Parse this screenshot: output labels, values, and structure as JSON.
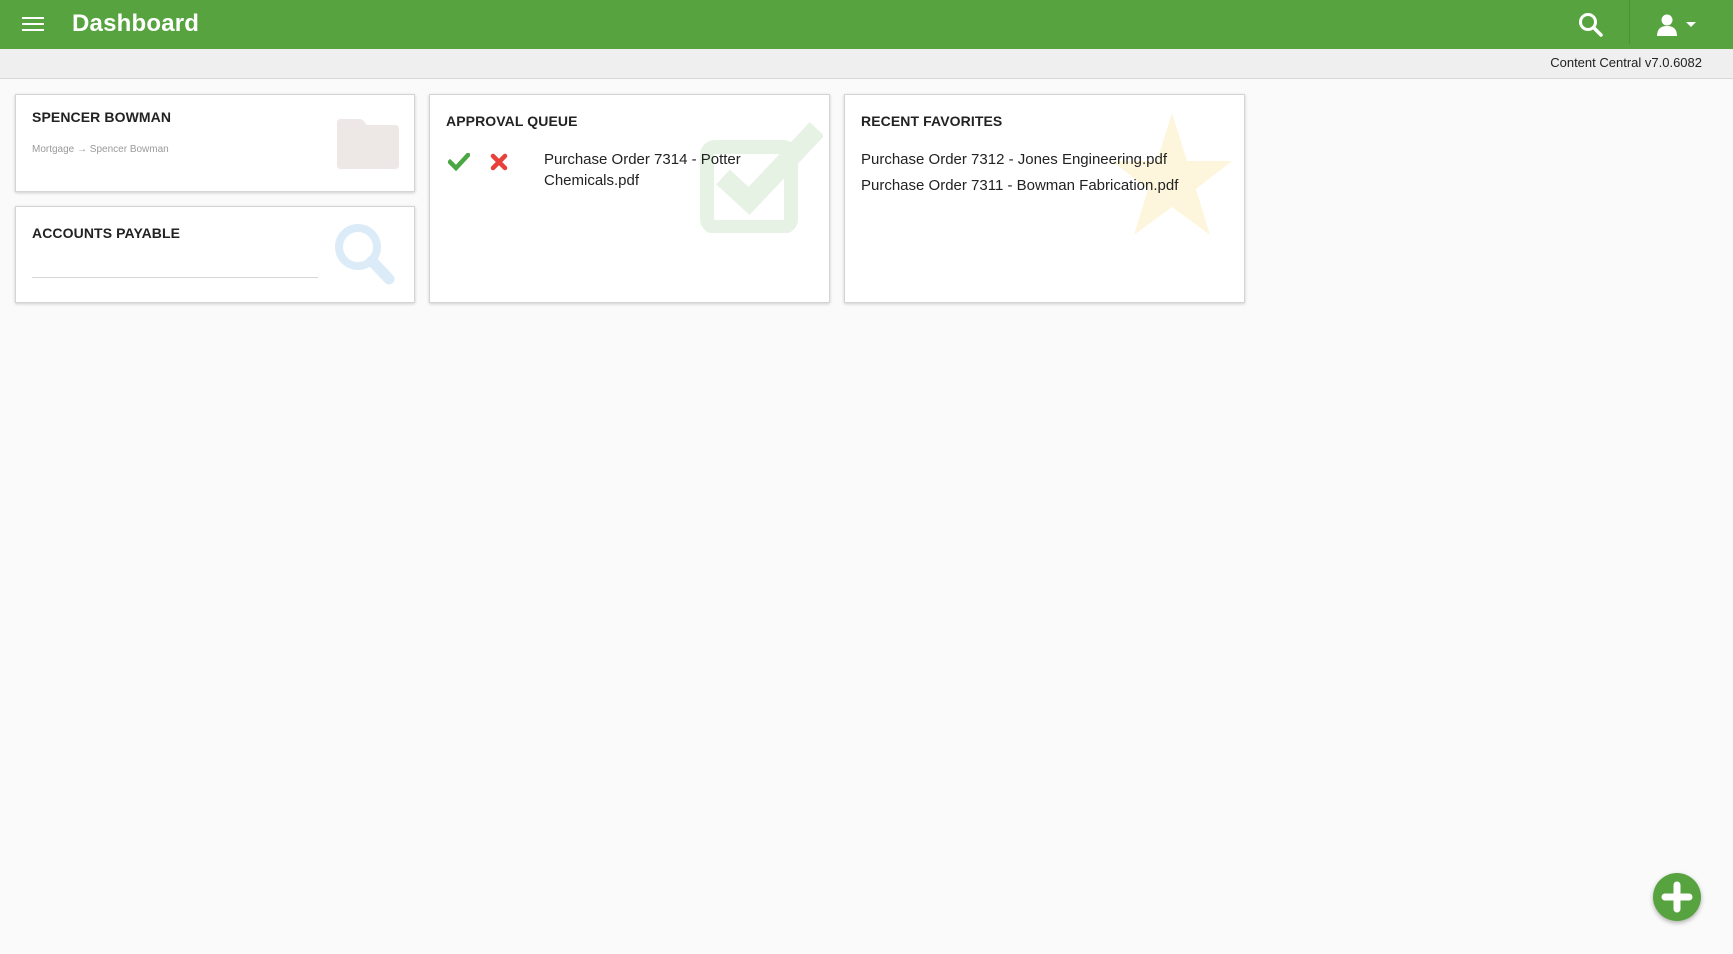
{
  "header": {
    "title": "Dashboard",
    "menu_icon": "hamburger-menu-icon",
    "search_icon": "search-icon",
    "user_icon": "user-icon",
    "brand_color": "#57a33f"
  },
  "version": "Content Central v7.0.6082",
  "cards": {
    "folder": {
      "title": "SPENCER BOWMAN",
      "breadcrumb": "Mortgage → Spencer Bowman",
      "icon": "folder-icon"
    },
    "search": {
      "title": "ACCOUNTS PAYABLE",
      "icon": "search-icon"
    },
    "approval": {
      "title": "APPROVAL QUEUE",
      "icon": "checkbox-icon",
      "items": [
        {
          "name": "Purchase Order 7314 - Potter Chemicals.pdf"
        }
      ]
    },
    "favorites": {
      "title": "RECENT FAVORITES",
      "icon": "star-icon",
      "items": [
        "Purchase Order 7312 - Jones Engineering.pdf",
        "Purchase Order 7311 - Bowman Fabrication.pdf"
      ]
    }
  },
  "fab": {
    "icon": "plus-icon"
  }
}
